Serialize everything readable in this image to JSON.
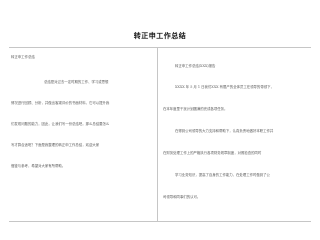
{
  "document": {
    "title": "转正申工作总结",
    "left_column": {
      "heading": "转正申工作总结",
      "lines": [
        "总结是对过去一定时期的工作、学习或思想",
        "情况进行回顾、分析，并做出客观评价的书面材料，它可以提升我",
        "们发现问题的能力，因此，让我们写一份总结吧。那么总结要怎么",
        "写才算合适呢？下面是我整理的转正申工作总结，欢迎大家",
        "借鉴与参考，希望对大家有所帮助。"
      ]
    },
    "right_column": {
      "heading": "转正申工作总结(XXX)报告",
      "lines": [
        "XXXX 年 5 月 1 日我们XXX 有限产的全体员工在领导的带领下，",
        "在本年度里干扰计划圆满的完成各项任务。",
        "在得到公司领导的大力支持和帮助下，认真负责地做好本职工作并",
        "在财务处理工作上的严格执行各项财务规章制度，对照检查的同时",
        "学习业务知识，提高了自身的工作能力，在处理工作时做到了公",
        "司领导和同事们的认可。"
      ]
    }
  }
}
